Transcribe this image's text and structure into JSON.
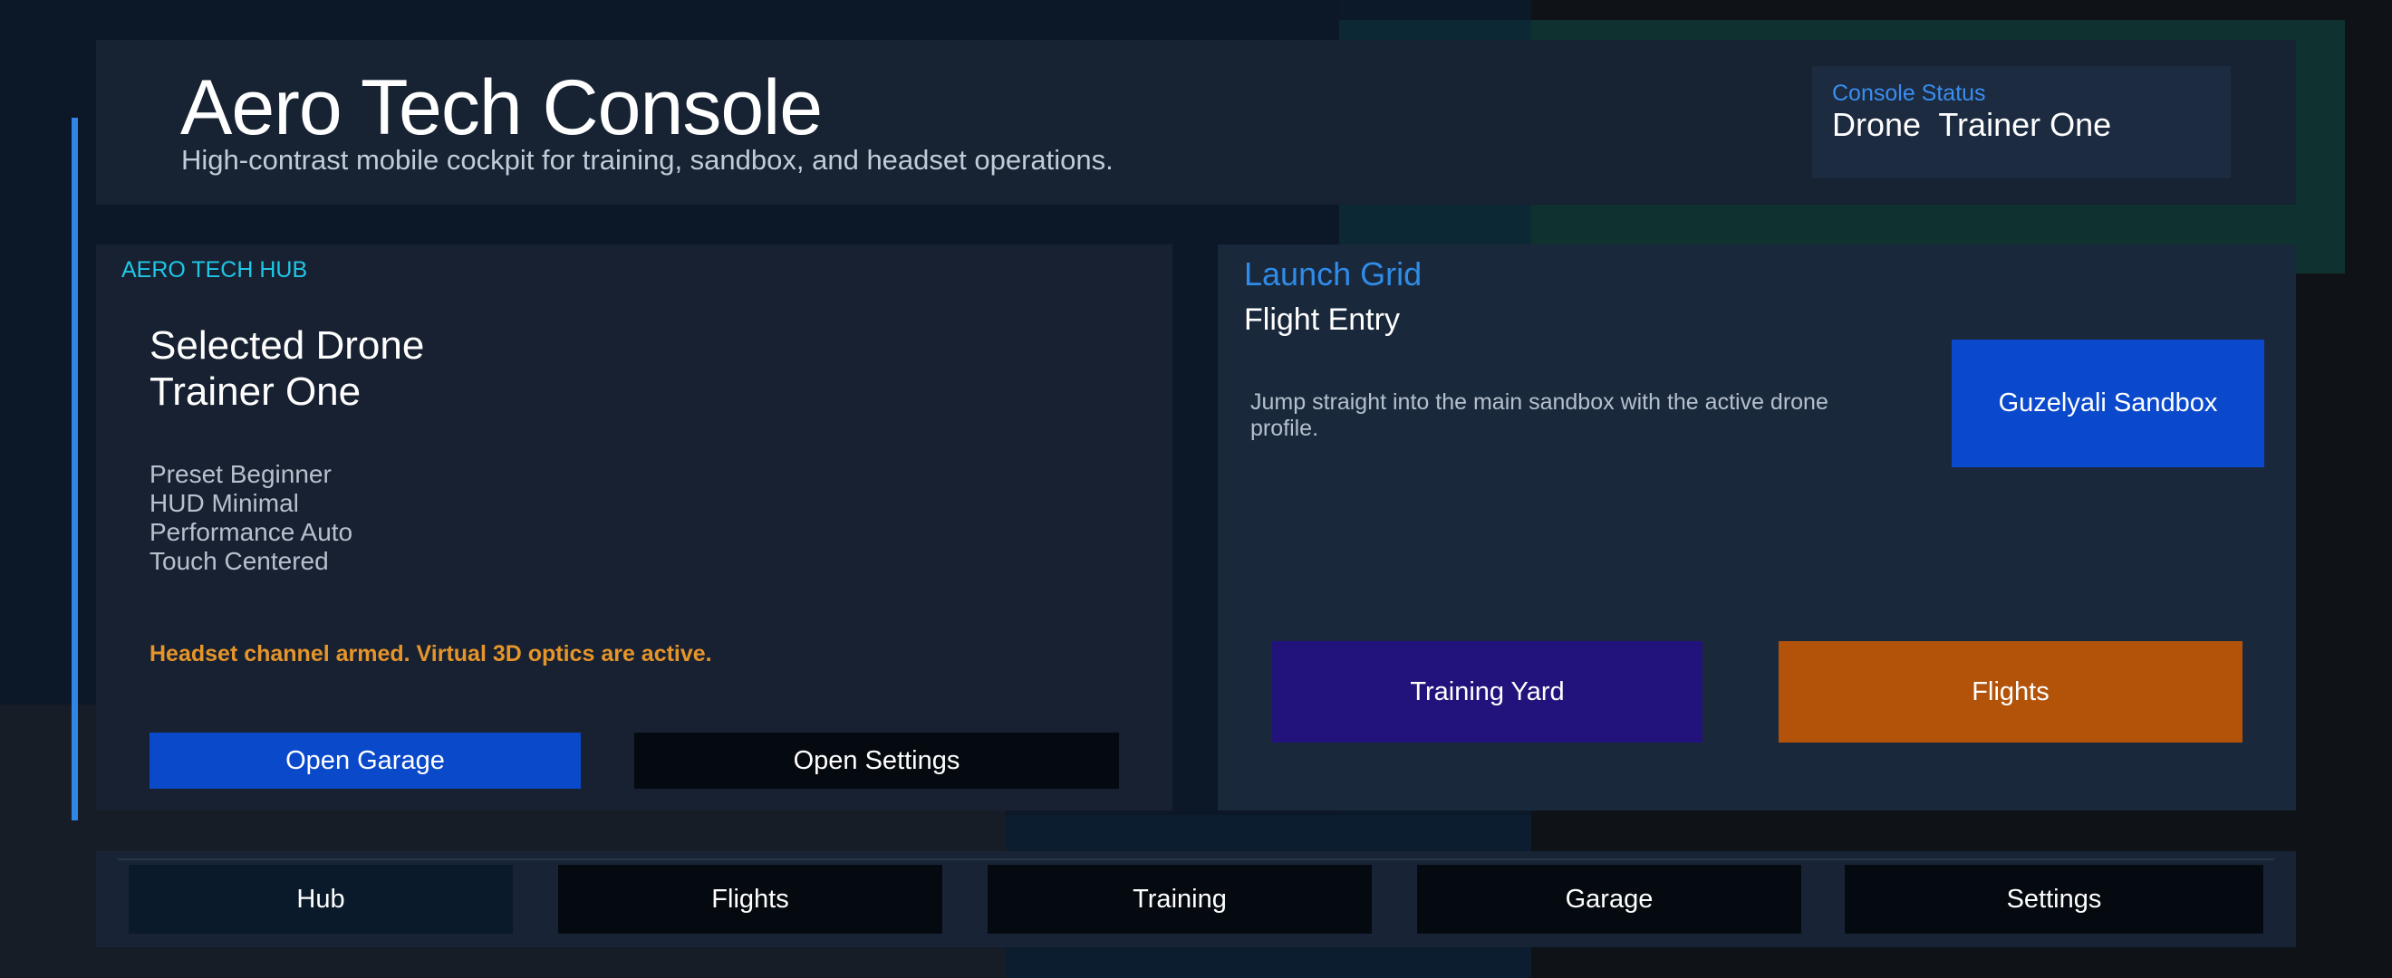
{
  "header": {
    "title": "Aero Tech Console",
    "subtitle": "High-contrast mobile cockpit for training, sandbox, and headset operations.",
    "status_label": "Console Status",
    "status_value": "Drone  Trainer One"
  },
  "hub": {
    "section_label": "AERO TECH HUB",
    "selected_line1": "Selected Drone",
    "selected_line2": "Trainer One",
    "specs": [
      "Preset Beginner",
      "HUD Minimal",
      "Performance Auto",
      "Touch Centered"
    ],
    "headset_status": "Headset channel armed. Virtual 3D optics are active.",
    "open_garage": "Open Garage",
    "open_settings": "Open Settings"
  },
  "launch": {
    "section_label": "Launch Grid",
    "flight_entry": "Flight Entry",
    "description": "Jump straight into the main sandbox with the active drone profile.",
    "sandbox_button": "Guzelyali Sandbox",
    "training_button": "Training Yard",
    "flights_button": "Flights"
  },
  "nav": {
    "items": [
      "Hub",
      "Flights",
      "Training",
      "Garage",
      "Settings"
    ]
  },
  "colors": {
    "accent_blue": "#2f86e6",
    "hub_cyan": "#1fc6e6",
    "warning_orange": "#e5952a",
    "primary_button": "#0a49c9",
    "training_purple": "#22137c",
    "flights_orange": "#b3530a"
  }
}
